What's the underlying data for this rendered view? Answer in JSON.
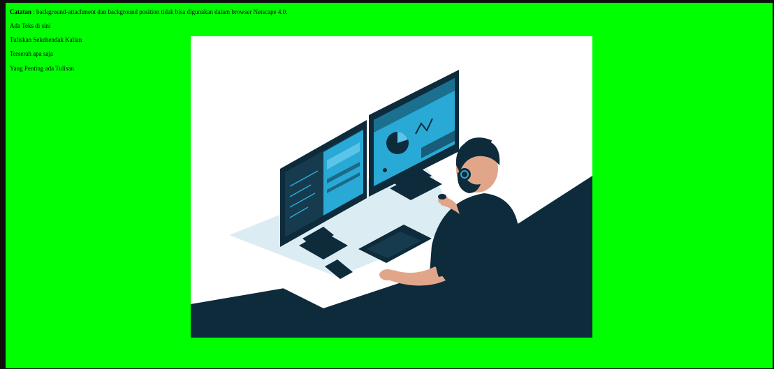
{
  "note": {
    "label": "Catatan",
    "text": " : background-attachment dan background position tidak bisa digunakan dalam browser Netscape 4.0."
  },
  "lines": [
    "Ada Teks di sini",
    "Tuliskan Sekehendak Kalian",
    "Terserah apa saja",
    "Yang Penting ada Tulisan"
  ],
  "colors": {
    "page_background": "#00ff00",
    "illustration_dark": "#0d2b3a",
    "illustration_accent": "#29a9d6"
  },
  "image": {
    "icon": "person-at-dual-monitors-illustration"
  }
}
